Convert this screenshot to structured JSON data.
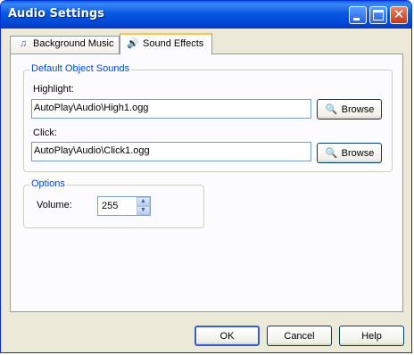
{
  "window": {
    "title": "Audio Settings"
  },
  "title_buttons": {
    "minimize": "minimize",
    "maximize": "maximize",
    "close": "✕"
  },
  "tabs": [
    {
      "label": "Background Music",
      "icon": "music-note-icon"
    },
    {
      "label": "Sound Effects",
      "icon": "speaker-icon"
    }
  ],
  "default_sounds": {
    "legend": "Default Object Sounds",
    "highlight": {
      "label": "Highlight:",
      "value": "AutoPlay\\Audio\\High1.ogg",
      "browse_label": "Browse"
    },
    "click": {
      "label": "Click:",
      "value": "AutoPlay\\Audio\\Click1.ogg",
      "browse_label": "Browse"
    }
  },
  "options": {
    "legend": "Options",
    "volume_label": "Volume:",
    "volume_value": "255"
  },
  "footer": {
    "ok_label": "OK",
    "cancel_label": "Cancel",
    "help_label": "Help"
  }
}
